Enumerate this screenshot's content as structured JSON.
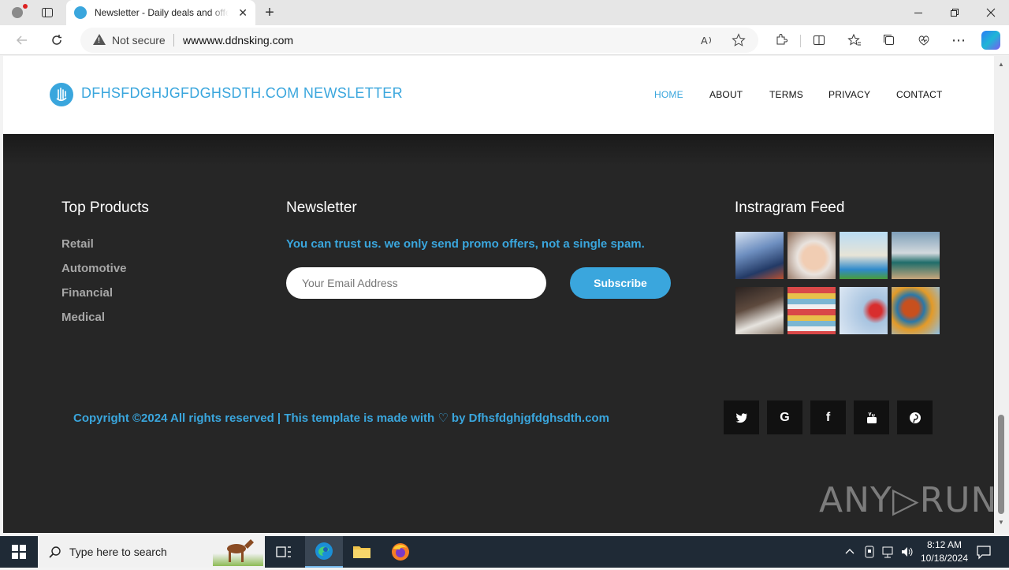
{
  "browser": {
    "tab_title": "Newsletter - Daily deals and offers",
    "tab_close": "✕",
    "new_tab": "+",
    "not_secure": "Not secure",
    "url": "wwwww.ddnsking.com",
    "window_controls": [
      "—",
      "❐",
      "✕"
    ]
  },
  "site": {
    "brand": "DFHSFDGHJGFDGHSDTH.COM  NEWSLETTER",
    "nav": [
      {
        "label": "HOME",
        "active": true
      },
      {
        "label": "ABOUT",
        "active": false
      },
      {
        "label": "TERMS",
        "active": false
      },
      {
        "label": "PRIVACY",
        "active": false
      },
      {
        "label": "CONTACT",
        "active": false
      }
    ],
    "accent_color": "#3aa6dd"
  },
  "footer": {
    "top_products": {
      "title": "Top Products",
      "items": [
        "Retail",
        "Automotive",
        "Financial",
        "Medical"
      ]
    },
    "newsletter": {
      "title": "Newsletter",
      "tagline": "You can trust us. we only send promo offers, not a single spam.",
      "email_placeholder": "Your Email Address",
      "subscribe_label": "Subscribe"
    },
    "instagram": {
      "title": "Instragram Feed",
      "images": [
        "laptop-keyboard",
        "spa-woman",
        "travel-landmarks",
        "beach-hammock",
        "finance-desk",
        "store-shelves",
        "medical-doctor",
        "mandala-pattern"
      ]
    },
    "copyright": "Copyright ©2024 All rights reserved | This template is made with ♡ by Dfhsfdghjgfdghsdth.com",
    "social": [
      {
        "icon": "twitter-icon",
        "glyph": "𝕥"
      },
      {
        "icon": "google-icon",
        "glyph": "G"
      },
      {
        "icon": "facebook-icon",
        "glyph": "f"
      },
      {
        "icon": "youtube-icon",
        "glyph": "▶"
      },
      {
        "icon": "pinterest-icon",
        "glyph": "℗"
      }
    ]
  },
  "watermark": "ANY▷RUN",
  "taskbar": {
    "search_placeholder": "Type here to search",
    "time": "8:12 AM",
    "date": "10/18/2024"
  }
}
